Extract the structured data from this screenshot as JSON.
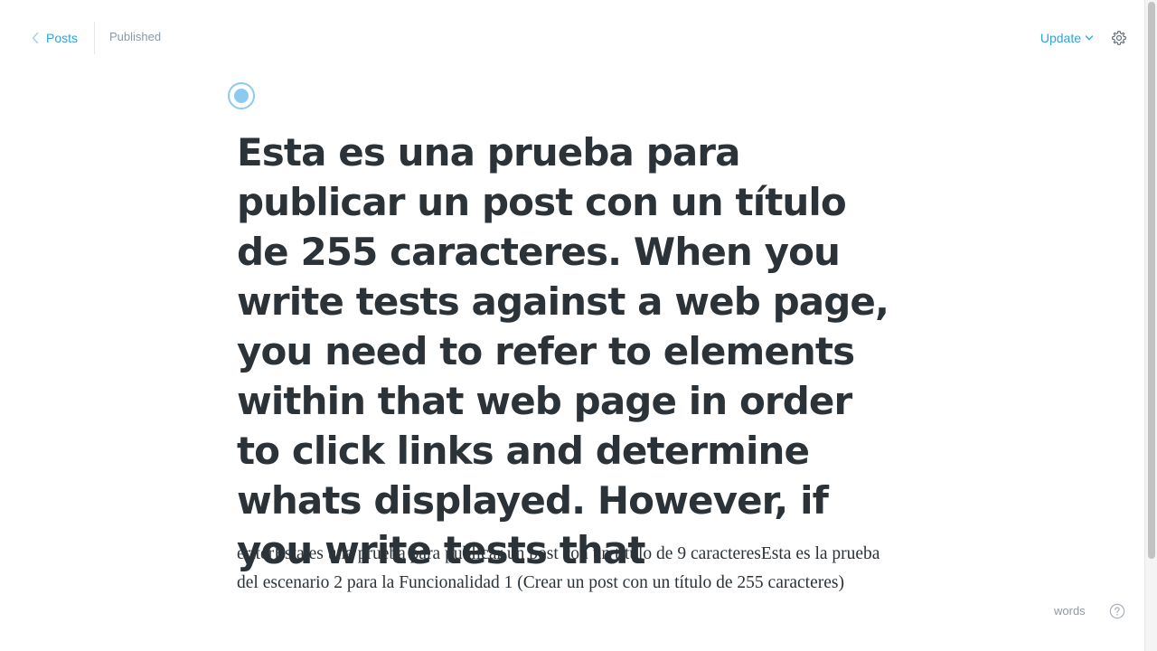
{
  "header": {
    "back_label": "Posts",
    "status": "Published",
    "update_label": "Update"
  },
  "editor": {
    "title": "Esta es una prueba para publicar un post con un título de 255 caracteres. When you write tests against a web page, you need to refer to elements within that web page in order to click links and determine whats displayed. However, if you write tests that",
    "body": "ertterEsta es una prueba para publicar un post con un título de 9 caracteresEsta es la prueba del escenario 2 para la Funcionalidad 1 (Crear un post con un título de 255 caracteres)"
  },
  "footer": {
    "word_count": "words"
  },
  "icons": {
    "back": "chevron-left-icon",
    "update_caret": "chevron-down-icon",
    "settings": "gear-icon",
    "help": "question-circle-icon",
    "feature_image": "image-placeholder-icon"
  },
  "colors": {
    "accent": "#2fa3d8",
    "text": "#2b3338",
    "muted": "#8e9aa3"
  }
}
